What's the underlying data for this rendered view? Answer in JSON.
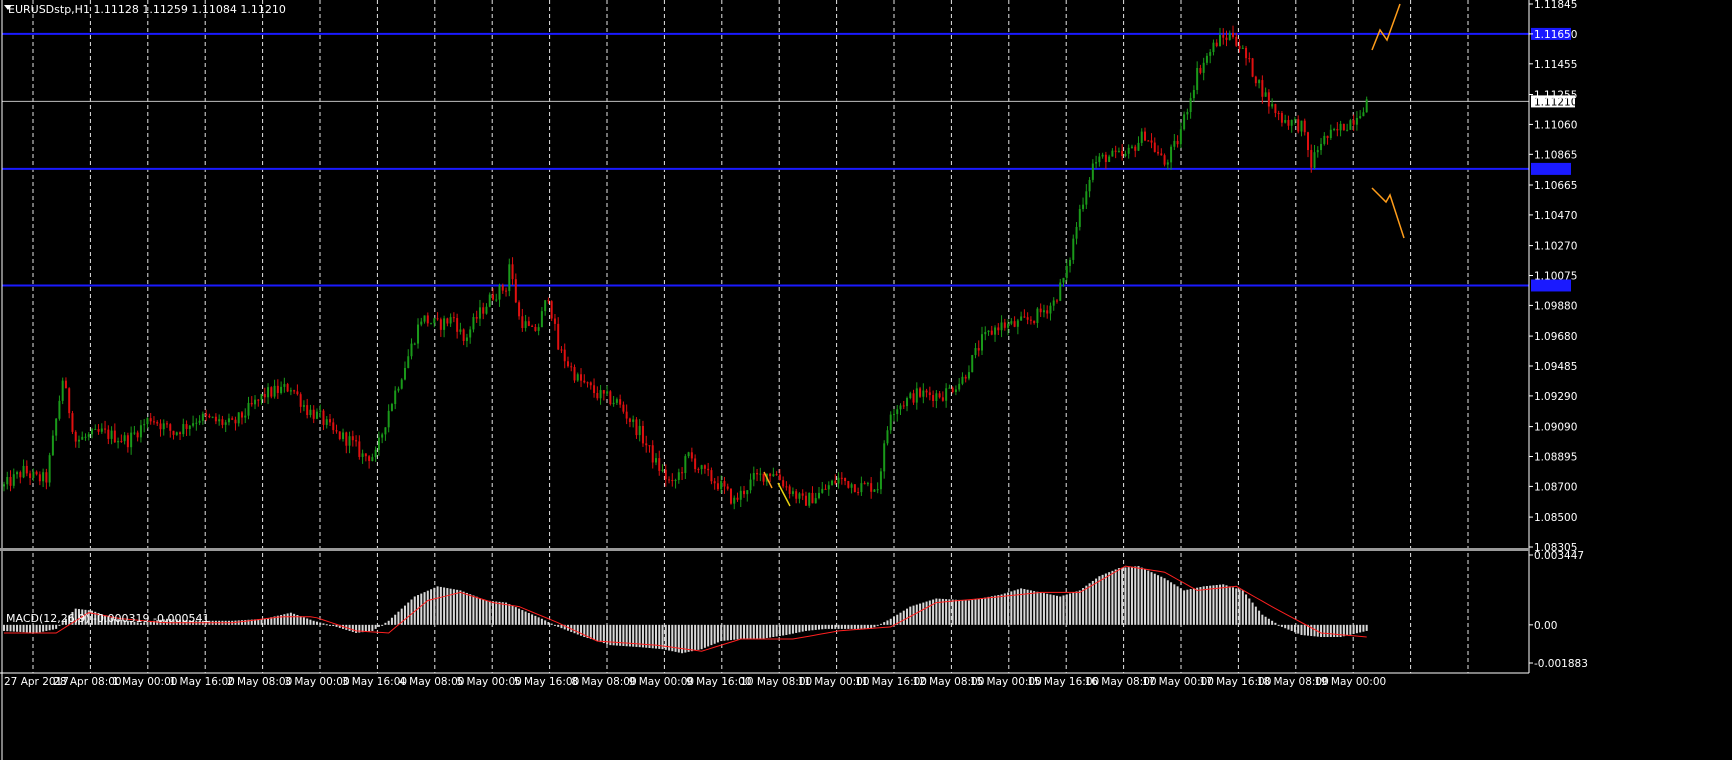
{
  "chart_data": [
    {
      "type": "candlestick",
      "title": "EURUSDstp,H1  1.11128 1.11259 1.11084 1.11210",
      "symbol": "EURUSDstp",
      "timeframe": "H1",
      "ohlc_current": {
        "open": 1.11128,
        "high": 1.11259,
        "low": 1.11084,
        "close": 1.1121
      },
      "y_ticks": [
        "1.11845",
        "1.11650",
        "1.11455",
        "1.11255",
        "1.11060",
        "1.10865",
        "1.10665",
        "1.10470",
        "1.10270",
        "1.10075",
        "1.09880",
        "1.09680",
        "1.09485",
        "1.09290",
        "1.09090",
        "1.08895",
        "1.08700",
        "1.08500",
        "1.08305"
      ],
      "ylim": [
        1.08305,
        1.11845
      ],
      "x_ticks": [
        "27 Apr 2017",
        "28 Apr 08:00",
        "1 May 00:00",
        "1 May 16:00",
        "2 May 08:00",
        "3 May 00:00",
        "3 May 16:00",
        "4 May 08:00",
        "5 May 00:00",
        "5 May 16:00",
        "8 May 08:00",
        "9 May 00:00",
        "9 May 16:00",
        "10 May 08:00",
        "11 May 00:00",
        "11 May 16:00",
        "12 May 08:00",
        "15 May 00:00",
        "15 May 16:00",
        "16 May 08:00",
        "17 May 00:00",
        "17 May 16:00",
        "18 May 08:00",
        "19 May 00:00"
      ],
      "current_price_label": "1.11210",
      "level_lines": [
        1.1165,
        1.1077,
        1.1001
      ],
      "grid": true,
      "colors": {
        "background": "#000000",
        "up": "#1a9a1a",
        "down": "#e01010",
        "levels": "#1a1aff",
        "projection": "#ff9d1a",
        "grid": "#ffffff"
      },
      "anchors": [
        [
          0,
          1.087
        ],
        [
          6,
          1.088
        ],
        [
          10,
          1.0875
        ],
        [
          13,
          1.0875
        ],
        [
          15,
          1.09
        ],
        [
          18,
          1.094
        ],
        [
          22,
          1.09
        ],
        [
          30,
          1.0905
        ],
        [
          38,
          1.09
        ],
        [
          45,
          1.0915
        ],
        [
          52,
          1.0905
        ],
        [
          60,
          1.0915
        ],
        [
          70,
          1.091
        ],
        [
          80,
          1.093
        ],
        [
          88,
          1.0935
        ],
        [
          93,
          1.092
        ],
        [
          97,
          1.0915
        ],
        [
          101,
          1.0905
        ],
        [
          106,
          1.09
        ],
        [
          110,
          1.089
        ],
        [
          114,
          1.089
        ],
        [
          118,
          1.092
        ],
        [
          124,
          1.0955
        ],
        [
          128,
          1.098
        ],
        [
          133,
          1.0975
        ],
        [
          138,
          1.098
        ],
        [
          141,
          1.0965
        ],
        [
          145,
          1.098
        ],
        [
          150,
          1.0995
        ],
        [
          154,
          1.1
        ],
        [
          155,
          1.1015
        ],
        [
          158,
          1.098
        ],
        [
          162,
          1.097
        ],
        [
          164,
          1.0975
        ],
        [
          167,
          1.0995
        ],
        [
          170,
          1.096
        ],
        [
          176,
          1.094
        ],
        [
          182,
          1.093
        ],
        [
          188,
          1.0925
        ],
        [
          195,
          1.0905
        ],
        [
          200,
          1.0885
        ],
        [
          205,
          1.087
        ],
        [
          210,
          1.089
        ],
        [
          214,
          1.088
        ],
        [
          220,
          1.087
        ],
        [
          224,
          1.086
        ],
        [
          230,
          1.0875
        ],
        [
          236,
          1.088
        ],
        [
          240,
          1.087
        ],
        [
          245,
          1.086
        ],
        [
          250,
          1.0865
        ],
        [
          256,
          1.0875
        ],
        [
          262,
          1.087
        ],
        [
          268,
          1.087
        ],
        [
          272,
          1.092
        ],
        [
          280,
          1.093
        ],
        [
          288,
          1.093
        ],
        [
          294,
          1.094
        ],
        [
          300,
          1.0965
        ],
        [
          305,
          1.0975
        ],
        [
          310,
          1.0975
        ],
        [
          316,
          1.098
        ],
        [
          322,
          1.099
        ],
        [
          326,
          1.101
        ],
        [
          330,
          1.105
        ],
        [
          334,
          1.108
        ],
        [
          338,
          1.1085
        ],
        [
          344,
          1.1085
        ],
        [
          350,
          1.11
        ],
        [
          356,
          1.108
        ],
        [
          360,
          1.1095
        ],
        [
          366,
          1.114
        ],
        [
          372,
          1.116
        ],
        [
          377,
          1.1165
        ],
        [
          382,
          1.1145
        ],
        [
          388,
          1.112
        ],
        [
          392,
          1.111
        ],
        [
          398,
          1.1105
        ],
        [
          401,
          1.108
        ],
        [
          404,
          1.1095
        ],
        [
          408,
          1.11
        ],
        [
          414,
          1.111
        ],
        [
          418,
          1.1121
        ]
      ],
      "series": [
        {
          "name": "MACD(12,26,9)",
          "value": -0.000319
        },
        {
          "name": "signal",
          "value": -0.000541
        }
      ],
      "macd_title": "MACD(12,26,9) -0.000319 -0.000541",
      "macd_y_ticks": [
        "0.003447",
        "0.00",
        "-0.001883"
      ],
      "macd_ylim": [
        -0.001883,
        0.003447
      ],
      "macd_anchors": [
        [
          0,
          -0.0003
        ],
        [
          10,
          -0.0004
        ],
        [
          16,
          -0.0002
        ],
        [
          22,
          0.0008
        ],
        [
          27,
          0.0007
        ],
        [
          34,
          0.0003
        ],
        [
          42,
          0.0001
        ],
        [
          50,
          0.0003
        ],
        [
          60,
          0.0002
        ],
        [
          70,
          0.0002
        ],
        [
          80,
          0.0003
        ],
        [
          88,
          0.0006
        ],
        [
          95,
          0.0002
        ],
        [
          102,
          -0.0001
        ],
        [
          108,
          -0.0004
        ],
        [
          113,
          -0.0003
        ],
        [
          118,
          0.0002
        ],
        [
          126,
          0.0014
        ],
        [
          133,
          0.0019
        ],
        [
          140,
          0.0017
        ],
        [
          148,
          0.0012
        ],
        [
          154,
          0.0011
        ],
        [
          158,
          0.0008
        ],
        [
          165,
          0.0003
        ],
        [
          170,
          -0.0001
        ],
        [
          178,
          -0.0006
        ],
        [
          186,
          -0.001
        ],
        [
          195,
          -0.0011
        ],
        [
          202,
          -0.0012
        ],
        [
          208,
          -0.0014
        ],
        [
          214,
          -0.0012
        ],
        [
          220,
          -0.0008
        ],
        [
          226,
          -0.0007
        ],
        [
          232,
          -0.0007
        ],
        [
          240,
          -0.0005
        ],
        [
          246,
          -0.0003
        ],
        [
          252,
          -0.0002
        ],
        [
          260,
          -0.0002
        ],
        [
          266,
          -0.0002
        ],
        [
          272,
          0.0003
        ],
        [
          278,
          0.0009
        ],
        [
          286,
          0.0013
        ],
        [
          296,
          0.0012
        ],
        [
          306,
          0.0015
        ],
        [
          312,
          0.0018
        ],
        [
          318,
          0.0016
        ],
        [
          324,
          0.0014
        ],
        [
          330,
          0.0017
        ],
        [
          336,
          0.0024
        ],
        [
          342,
          0.0028
        ],
        [
          348,
          0.0029
        ],
        [
          356,
          0.0023
        ],
        [
          362,
          0.0017
        ],
        [
          368,
          0.0019
        ],
        [
          374,
          0.002
        ],
        [
          380,
          0.0017
        ],
        [
          386,
          0.0005
        ],
        [
          392,
          -0.0001
        ],
        [
          398,
          -0.0005
        ],
        [
          404,
          -0.0006
        ],
        [
          410,
          -0.0006
        ],
        [
          418,
          -0.0003
        ]
      ],
      "signal_anchors": [
        [
          0,
          -0.0004
        ],
        [
          16,
          -0.0004
        ],
        [
          26,
          0.0006
        ],
        [
          36,
          0.0003
        ],
        [
          50,
          0.0001
        ],
        [
          70,
          0.0001
        ],
        [
          85,
          0.0004
        ],
        [
          95,
          0.0004
        ],
        [
          108,
          -0.0003
        ],
        [
          118,
          -0.0004
        ],
        [
          130,
          0.0012
        ],
        [
          140,
          0.0016
        ],
        [
          150,
          0.0011
        ],
        [
          158,
          0.0009
        ],
        [
          170,
          0.0001
        ],
        [
          182,
          -0.0008
        ],
        [
          200,
          -0.001
        ],
        [
          214,
          -0.0013
        ],
        [
          226,
          -0.0007
        ],
        [
          242,
          -0.0007
        ],
        [
          256,
          -0.0003
        ],
        [
          272,
          -0.0001
        ],
        [
          286,
          0.0011
        ],
        [
          300,
          0.0013
        ],
        [
          318,
          0.0016
        ],
        [
          330,
          0.0016
        ],
        [
          344,
          0.0029
        ],
        [
          356,
          0.0026
        ],
        [
          366,
          0.0017
        ],
        [
          378,
          0.0019
        ],
        [
          390,
          0.0008
        ],
        [
          404,
          -0.0004
        ],
        [
          418,
          -0.0006
        ]
      ]
    }
  ]
}
